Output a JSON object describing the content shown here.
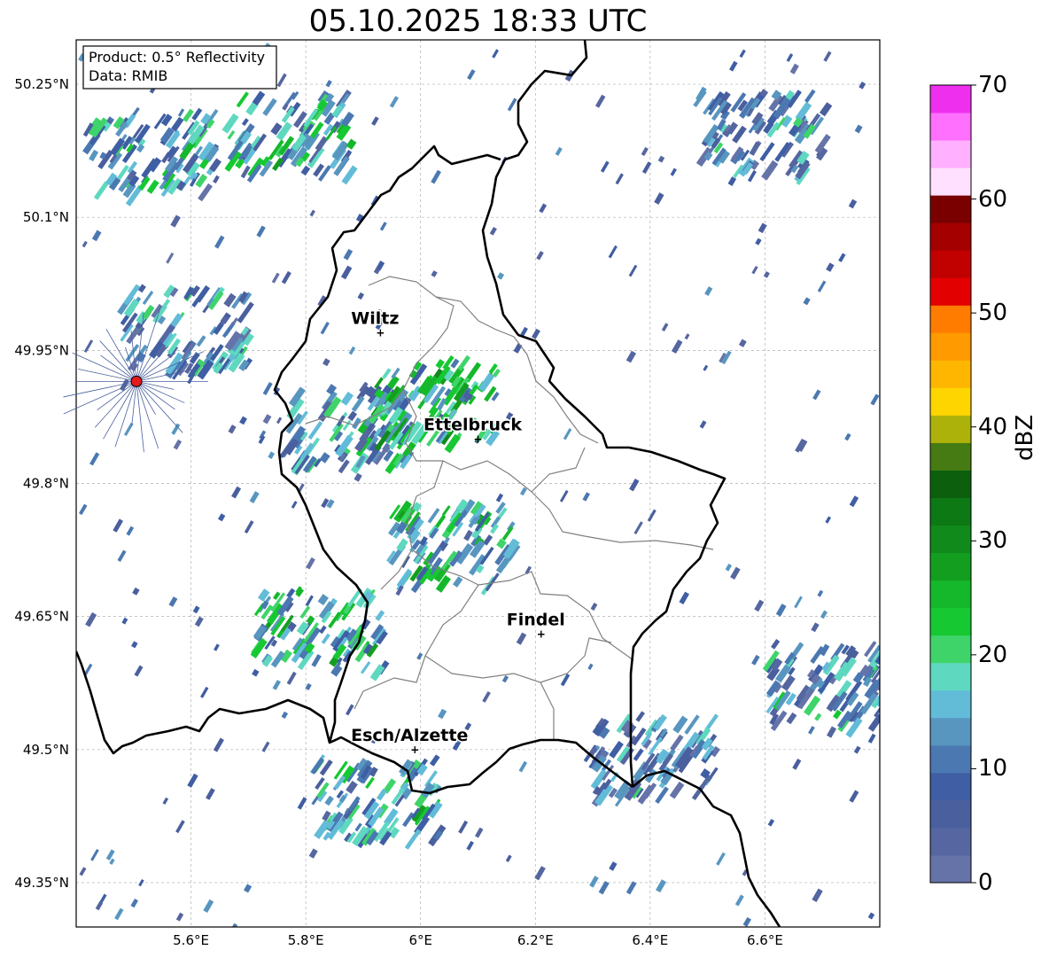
{
  "title": "05.10.2025 18:33 UTC",
  "info_box": {
    "product": "Product: 0.5° Reflectivity",
    "data": "Data: RMIB"
  },
  "axes": {
    "lon_ticks": [
      {
        "value": 5.6,
        "label": "5.6°E"
      },
      {
        "value": 5.8,
        "label": "5.8°E"
      },
      {
        "value": 6.0,
        "label": "6°E"
      },
      {
        "value": 6.2,
        "label": "6.2°E"
      },
      {
        "value": 6.4,
        "label": "6.4°E"
      },
      {
        "value": 6.6,
        "label": "6.6°E"
      }
    ],
    "lat_ticks": [
      {
        "value": 50.25,
        "label": "50.25°N"
      },
      {
        "value": 50.1,
        "label": "50.1°N"
      },
      {
        "value": 49.95,
        "label": "49.95°N"
      },
      {
        "value": 49.8,
        "label": "49.8°N"
      },
      {
        "value": 49.65,
        "label": "49.65°N"
      },
      {
        "value": 49.5,
        "label": "49.5°N"
      },
      {
        "value": 49.35,
        "label": "49.35°N"
      }
    ],
    "lon_range": [
      5.4,
      6.8
    ],
    "lat_range": [
      49.3,
      50.3
    ],
    "grid": true
  },
  "cities": [
    {
      "name": "Wiltz",
      "lon": 5.93,
      "lat": 49.97
    },
    {
      "name": "Ettelbruck",
      "lon": 6.1,
      "lat": 49.85
    },
    {
      "name": "Findel",
      "lon": 6.21,
      "lat": 49.63
    },
    {
      "name": "Esch/Alzette",
      "lon": 5.99,
      "lat": 49.5
    }
  ],
  "radar_site": {
    "lon": 5.505,
    "lat": 49.915,
    "color": "#e41a1c"
  },
  "colorbar": {
    "label": "dBZ",
    "min": 0,
    "max": 70,
    "ticks": [
      "0",
      "10",
      "20",
      "30",
      "40",
      "50",
      "60",
      "70"
    ],
    "colors": [
      "#6673a8",
      "#5566a0",
      "#4a5f9e",
      "#3f5ea3",
      "#4b78b1",
      "#5896c0",
      "#62bcd8",
      "#5fd8c0",
      "#3fd46a",
      "#16c832",
      "#15b82b",
      "#149e20",
      "#108a1b",
      "#0c7914",
      "#0c5f0c",
      "#467a12",
      "#adb20b",
      "#ffd500",
      "#ffb600",
      "#ff9a00",
      "#ff7c00",
      "#e30000",
      "#c10000",
      "#a50000",
      "#7a0000",
      "#ffe0ff",
      "#ffb0ff",
      "#ff70ff",
      "#ee30ee"
    ]
  },
  "chart_data": {
    "type": "heatmap",
    "title": "05.10.2025 18:33 UTC",
    "xlabel": "",
    "ylabel": "",
    "xlim": [
      5.4,
      6.8
    ],
    "ylim": [
      49.3,
      50.3
    ],
    "value_label": "dBZ",
    "value_range": [
      0,
      70
    ],
    "echo_clusters": [
      {
        "lon": 5.54,
        "lat": 50.18,
        "dbz": 18
      },
      {
        "lon": 5.78,
        "lat": 50.2,
        "dbz": 20
      },
      {
        "lon": 6.6,
        "lat": 50.2,
        "dbz": 15
      },
      {
        "lon": 5.6,
        "lat": 49.98,
        "dbz": 15
      },
      {
        "lon": 5.88,
        "lat": 49.87,
        "dbz": 18
      },
      {
        "lon": 6.03,
        "lat": 49.9,
        "dbz": 25
      },
      {
        "lon": 6.06,
        "lat": 49.74,
        "dbz": 22
      },
      {
        "lon": 5.83,
        "lat": 49.64,
        "dbz": 22
      },
      {
        "lon": 5.93,
        "lat": 49.45,
        "dbz": 20
      },
      {
        "lon": 6.72,
        "lat": 49.58,
        "dbz": 15
      },
      {
        "lon": 6.41,
        "lat": 49.5,
        "dbz": 14
      }
    ]
  }
}
